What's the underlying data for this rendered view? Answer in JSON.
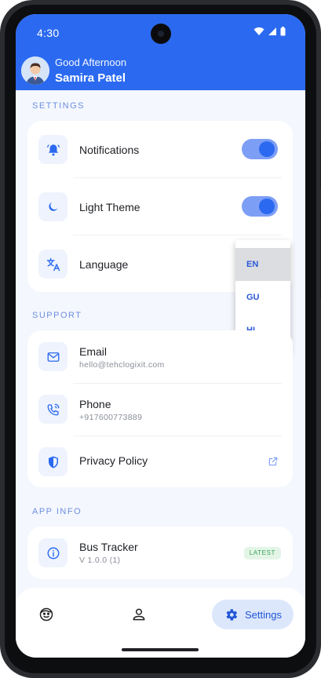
{
  "status_bar": {
    "time": "4:30"
  },
  "header": {
    "greeting": "Good Afternoon",
    "user_name": "Samira Patel",
    "avatar_icon": "user-avatar-icon"
  },
  "colors": {
    "primary": "#2b6af0",
    "toggle_track": "#7d9ef5",
    "background": "#f4f7fd",
    "section_label": "#6d8fe0",
    "badge_green": "#3ca356"
  },
  "settings": {
    "section_title": "SETTINGS",
    "notifications": {
      "label": "Notifications",
      "icon": "bell-icon",
      "enabled": true
    },
    "theme": {
      "label": "Light Theme",
      "icon": "moon-icon",
      "enabled": true
    },
    "language": {
      "label": "Language",
      "icon": "translate-icon",
      "options": [
        "EN",
        "GU",
        "HI"
      ],
      "selected": "EN"
    }
  },
  "support": {
    "section_title": "SUPPORT",
    "email": {
      "label": "Email",
      "value": "hello@tehclogixit.com",
      "icon": "mail-icon"
    },
    "phone": {
      "label": "Phone",
      "value": "+917600773889",
      "icon": "phone-icon"
    },
    "privacy": {
      "label": "Privacy Policy",
      "icon": "shield-icon",
      "action_icon": "external-link-icon"
    }
  },
  "app_info": {
    "section_title": "APP INFO",
    "app_name": "Bus Tracker",
    "version": "V 1.0.0 (1)",
    "badge": "LATEST",
    "icon": "info-icon"
  },
  "bottom_nav": {
    "items": [
      {
        "name": "face-icon"
      },
      {
        "name": "person-icon"
      },
      {
        "name": "gear-icon",
        "label": "Settings",
        "active": true
      }
    ]
  }
}
